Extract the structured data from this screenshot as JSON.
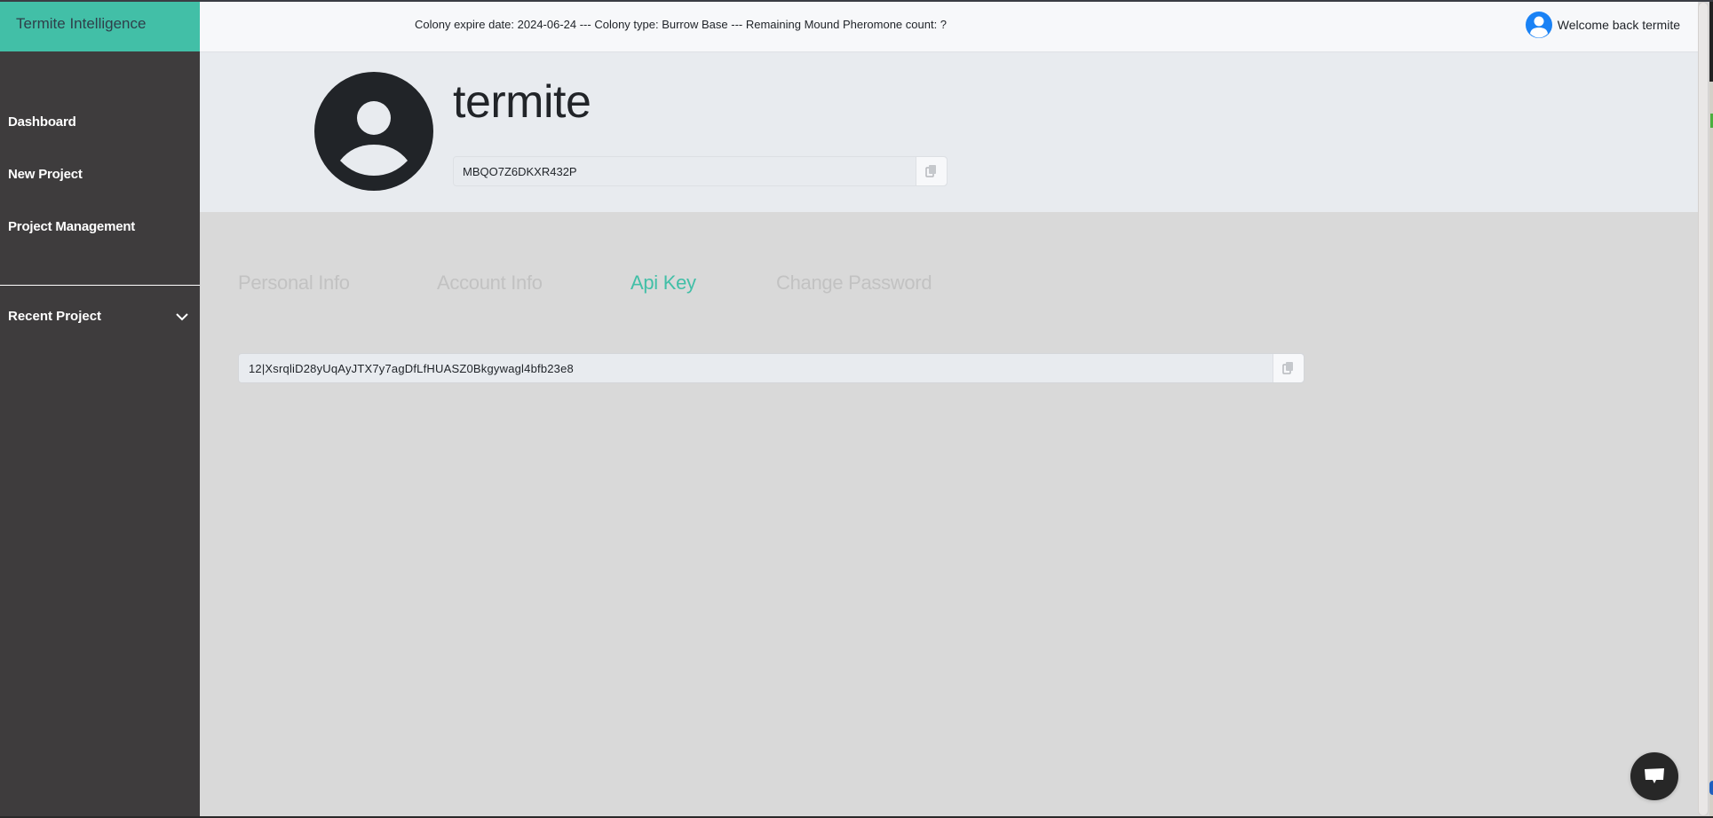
{
  "app": {
    "brand": "Termite Intelligence",
    "accent_color": "#42bfa7"
  },
  "header": {
    "colony_info": "Colony expire date: 2024-06-24 --- Colony type: Burrow Base --- Remaining Mound Pheromone count: ?",
    "welcome_text": "Welcome back termite",
    "avatar_icon": "user-circle-icon"
  },
  "sidebar": {
    "items": [
      {
        "label": "Dashboard"
      },
      {
        "label": "New Project"
      },
      {
        "label": "Project Management"
      }
    ],
    "recent_project": {
      "label": "Recent Project",
      "icon": "chevron-down-icon",
      "expanded": false
    }
  },
  "profile": {
    "username": "termite",
    "user_id": "MBQO7Z6DKXR432P",
    "copy_icon": "copy-icon",
    "avatar_icon": "user-circle-icon"
  },
  "tabs": [
    {
      "label": "Personal Info",
      "active": false
    },
    {
      "label": "Account Info",
      "active": false
    },
    {
      "label": "Api Key",
      "active": true
    },
    {
      "label": "Change Password",
      "active": false
    }
  ],
  "api_key": {
    "value": "12|XsrqliD28yUqAyJTX7y7agDfLfHUASZ0Bkgywagl4bfb23e8",
    "copy_icon": "copy-icon"
  },
  "chat": {
    "icon": "chat-bubble-icon"
  }
}
